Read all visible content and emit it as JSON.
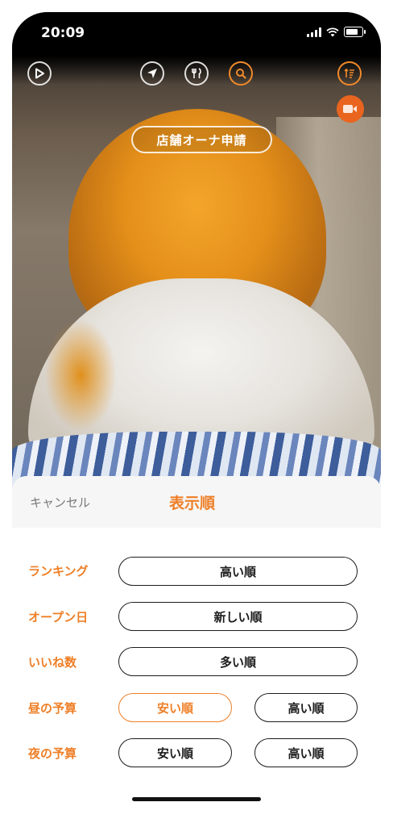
{
  "status": {
    "time": "20:09"
  },
  "overlay": {
    "owner_button": "店舗オーナ申請",
    "icons": [
      "play-icon",
      "location-arrow-icon",
      "fork-knife-icon",
      "search-icon",
      "sort-icon",
      "video-camera-icon"
    ]
  },
  "sheet": {
    "cancel": "キャンセル",
    "title": "表示順",
    "rows": [
      {
        "label": "ランキング",
        "options": [
          "高い順"
        ]
      },
      {
        "label": "オープン日",
        "options": [
          "新しい順"
        ]
      },
      {
        "label": "いいね数",
        "options": [
          "多い順"
        ]
      },
      {
        "label": "昼の予算",
        "options": [
          "安い順",
          "高い順"
        ],
        "selected": "安い順"
      },
      {
        "label": "夜の予算",
        "options": [
          "安い順",
          "高い順"
        ]
      }
    ]
  },
  "colors": {
    "accent": "#ee7f27",
    "sheet_header_bg": "#f6f6f6",
    "pill_border": "#1c1c1c"
  }
}
